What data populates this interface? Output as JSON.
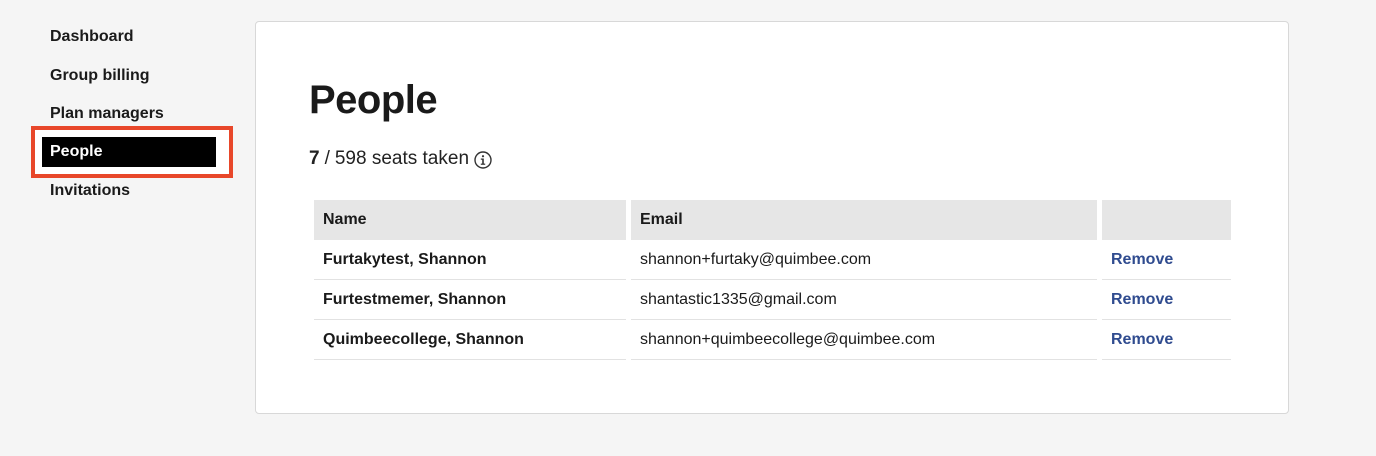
{
  "sidebar": {
    "items": [
      {
        "label": "Dashboard"
      },
      {
        "label": "Group billing"
      },
      {
        "label": "Plan managers"
      },
      {
        "label": "People",
        "active": true
      },
      {
        "label": "Invitations"
      }
    ],
    "highlight_color": "#e8472a"
  },
  "main": {
    "title": "People",
    "seats": {
      "taken": "7",
      "separator": "/",
      "rest": "598 seats taken",
      "icon": "info-icon"
    },
    "table": {
      "columns": [
        "Name",
        "Email",
        ""
      ],
      "rows": [
        {
          "name": "Furtakytest, Shannon",
          "email": "shannon+furtaky@quimbee.com",
          "action": "Remove"
        },
        {
          "name": "Furtestmemer, Shannon",
          "email": "shantastic1335@gmail.com",
          "action": "Remove"
        },
        {
          "name": "Quimbeecollege, Shannon",
          "email": "shannon+quimbeecollege@quimbee.com",
          "action": "Remove"
        }
      ]
    },
    "link_color": "#2f4b8f"
  }
}
